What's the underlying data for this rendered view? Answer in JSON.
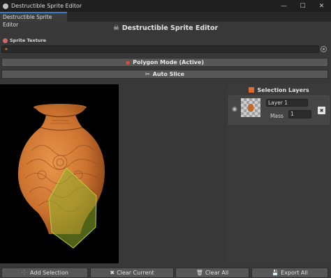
{
  "window": {
    "title": "Destructible Sprite Editor",
    "controls": {
      "minimize": "—",
      "maximize": "☐",
      "close": "✕"
    }
  },
  "tab": {
    "label": "Destructible Sprite Editor"
  },
  "header": {
    "icon": "skull-icon",
    "title": "Destructible Sprite Editor"
  },
  "sprite_texture": {
    "label": "Sprite Texture",
    "icon": "texture-icon"
  },
  "buttons": {
    "polygon_mode": {
      "icon": "record-icon",
      "label": "Polygon Mode (Active)"
    },
    "auto_slice": {
      "icon": "scissors-icon",
      "label": "Auto Slice"
    }
  },
  "canvas": {
    "content": "vase-sprite",
    "selection_color": "#8fb22c"
  },
  "layers": {
    "icon": "layers-icon",
    "title": "Selection Layers",
    "items": [
      {
        "name": "Layer 1",
        "mass_label": "Mass",
        "mass": "1",
        "visible": true
      }
    ]
  },
  "bottom": {
    "add_selection": "Add Selection",
    "clear_current": "Clear Current",
    "clear_all": "Clear All",
    "export_all": "Export All"
  },
  "colors": {
    "accent": "#3a79c5",
    "vase": "#d07a34",
    "record": "#e0483a"
  }
}
